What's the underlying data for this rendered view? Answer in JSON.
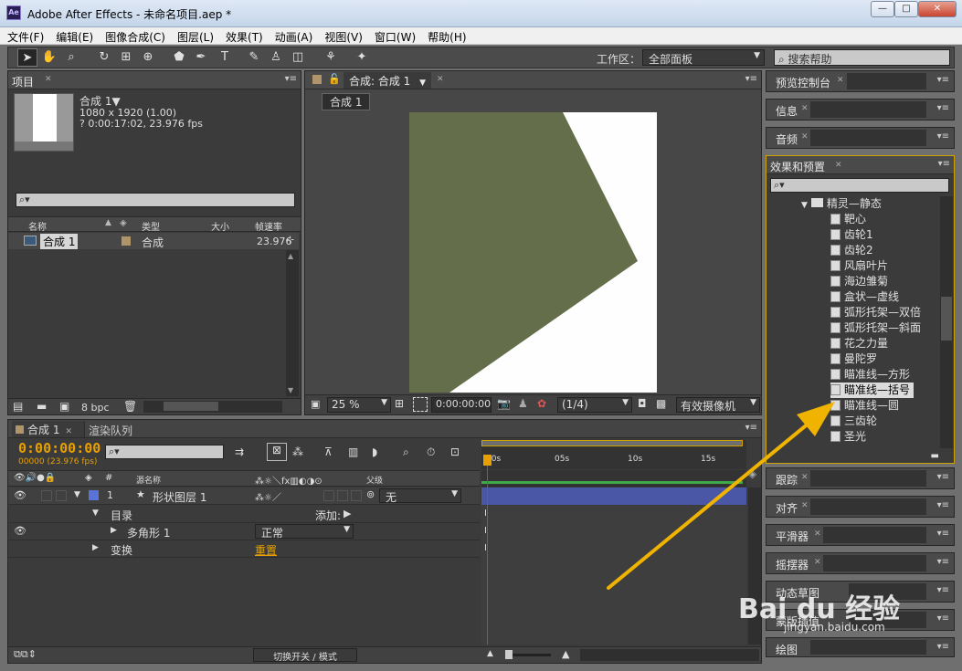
{
  "window": {
    "title": "Adobe After Effects - 未命名项目.aep *",
    "app_icon": "Ae",
    "controls": [
      "—",
      "□",
      "✕"
    ]
  },
  "menu": [
    "文件(F)",
    "编辑(E)",
    "图像合成(C)",
    "图层(L)",
    "效果(T)",
    "动画(A)",
    "视图(V)",
    "窗口(W)",
    "帮助(H)"
  ],
  "toolbar": {
    "workspace_label": "工作区：",
    "workspace_value": "全部面板",
    "search_placeholder": "搜索帮助"
  },
  "project": {
    "tab": "项目",
    "comp_name": "合成 1▼",
    "comp_info1": "1080 x 1920 (1.00)",
    "comp_info2": "? 0:00:17:02, 23.976 fps",
    "search_placeholder": "⌕▾",
    "columns": [
      "名称",
      "类型",
      "大小",
      "帧速率"
    ],
    "rows": [
      {
        "name": "合成 1",
        "type": "合成",
        "fps": "23.976"
      }
    ],
    "bpc": "8 bpc"
  },
  "composition": {
    "tab": "合成: 合成 1",
    "subtab": "合成 1",
    "zoom": "25 %",
    "timecode": "0:00:00:00",
    "resolution": "(1/4)",
    "camera": "有效摄像机",
    "bg_color": "#fefefe",
    "shape_color": "#646e4b"
  },
  "right_panels": {
    "preview": "预览控制台",
    "info": "信息",
    "audio": "音频",
    "effects": "效果和预置",
    "folder": "精灵—静态",
    "effects_list": [
      "靶心",
      "齿轮1",
      "齿轮2",
      "风扇叶片",
      "海边雏菊",
      "盒状—虚线",
      "弧形托架—双倍",
      "弧形托架—斜面",
      "花之力量",
      "曼陀罗",
      "瞄准线—方形",
      "瞄准线—括号",
      "瞄准线—圆",
      "三齿轮",
      "圣光"
    ],
    "selected_effect": "瞄准线—括号",
    "lower": [
      "跟踪",
      "对齐",
      "平滑器",
      "摇摆器",
      "动态草图",
      "蒙版插值",
      "绘图"
    ]
  },
  "timeline": {
    "tabs": [
      "合成 1",
      "渲染队列"
    ],
    "timecode": "0:00:00:00",
    "fps_line": "00000 (23.976 fps)",
    "col_source": "源名称",
    "col_parent": "父级",
    "layer_num": "1",
    "layer_name": "形状图层 1",
    "parent_value": "无",
    "content_label": "目录",
    "add_label": "添加:",
    "polygon": "多角形 1",
    "blend_mode": "正常",
    "transform": "变换",
    "reset": "重置",
    "ruler": [
      ":00s",
      "05s",
      "10s",
      "15s"
    ],
    "footer": "切换开关 / 模式"
  },
  "watermark": {
    "brand": "Bai du 经验",
    "url": "jingyan.baidu.com"
  },
  "colors": {
    "accent": "#f0b400",
    "panel": "#3b3b3b",
    "layer_bar": "#4a56a6"
  }
}
